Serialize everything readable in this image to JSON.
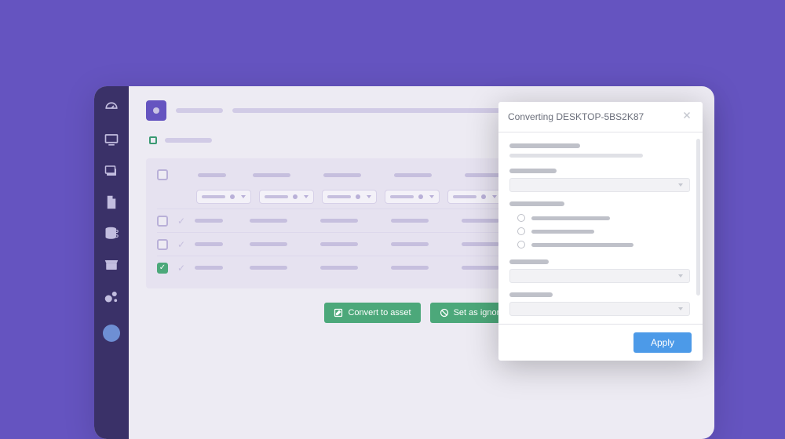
{
  "sidebar": {
    "items": [
      {
        "name": "dashboard-icon"
      },
      {
        "name": "desktop-icon"
      },
      {
        "name": "stack-icon"
      },
      {
        "name": "document-icon"
      },
      {
        "name": "database-icon"
      },
      {
        "name": "archive-icon"
      },
      {
        "name": "bubbles-icon"
      }
    ]
  },
  "actions": {
    "convert_label": "Convert to asset",
    "ignore_label": "Set as ignored"
  },
  "dialog": {
    "title": "Converting DESKTOP-5BS2K87",
    "apply_label": "Apply"
  },
  "colors": {
    "brand": "#6554C0",
    "sidebar": "#3A3168",
    "accent_green": "#4CA87A",
    "accent_teal": "#2B9AA8",
    "accent_blue": "#4C9AE8"
  }
}
